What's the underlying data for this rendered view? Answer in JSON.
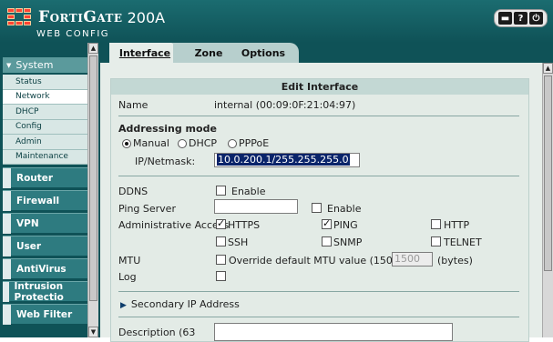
{
  "header": {
    "brand": "FortiGate",
    "model": "200A",
    "subtitle": "WEB CONFIG",
    "icons": [
      "chat-icon",
      "help-icon",
      "logout-icon"
    ]
  },
  "sidebar": {
    "system_label": "System",
    "sub_items": [
      {
        "label": "Status"
      },
      {
        "label": "Network"
      },
      {
        "label": "DHCP"
      },
      {
        "label": "Config"
      },
      {
        "label": "Admin"
      },
      {
        "label": "Maintenance"
      }
    ],
    "groups": [
      {
        "label": "Router"
      },
      {
        "label": "Firewall"
      },
      {
        "label": "VPN"
      },
      {
        "label": "User"
      },
      {
        "label": "AntiVirus"
      },
      {
        "label": "Intrusion Protectio"
      },
      {
        "label": "Web Filter"
      }
    ]
  },
  "tabs": [
    {
      "label": "Interface",
      "active": true
    },
    {
      "label": "Zone",
      "active": false
    },
    {
      "label": "Options",
      "active": false
    }
  ],
  "form": {
    "title": "Edit Interface",
    "name_label": "Name",
    "name_value": "internal (00:09:0F:21:04:97)",
    "addressing_label": "Addressing mode",
    "mode_manual": "Manual",
    "mode_dhcp": "DHCP",
    "mode_pppoe": "PPPoE",
    "ipmask_label": "IP/Netmask:",
    "ipmask_value": "10.0.200.1/255.255.255.0",
    "ddns_label": "DDNS",
    "enable_label": "Enable",
    "ping_server_label": "Ping Server",
    "ping_enable_label": "Enable",
    "admin_access_label": "Administrative Access",
    "access": {
      "https": "HTTPS",
      "ping": "PING",
      "http": "HTTP",
      "ssh": "SSH",
      "snmp": "SNMP",
      "telnet": "TELNET"
    },
    "mtu_label": "MTU",
    "mtu_override_label": "Override default MTU value (1500).",
    "mtu_value": "1500",
    "mtu_unit": "(bytes)",
    "log_label": "Log",
    "secondary_ip_label": "Secondary IP Address",
    "description_label": "Description (63"
  }
}
